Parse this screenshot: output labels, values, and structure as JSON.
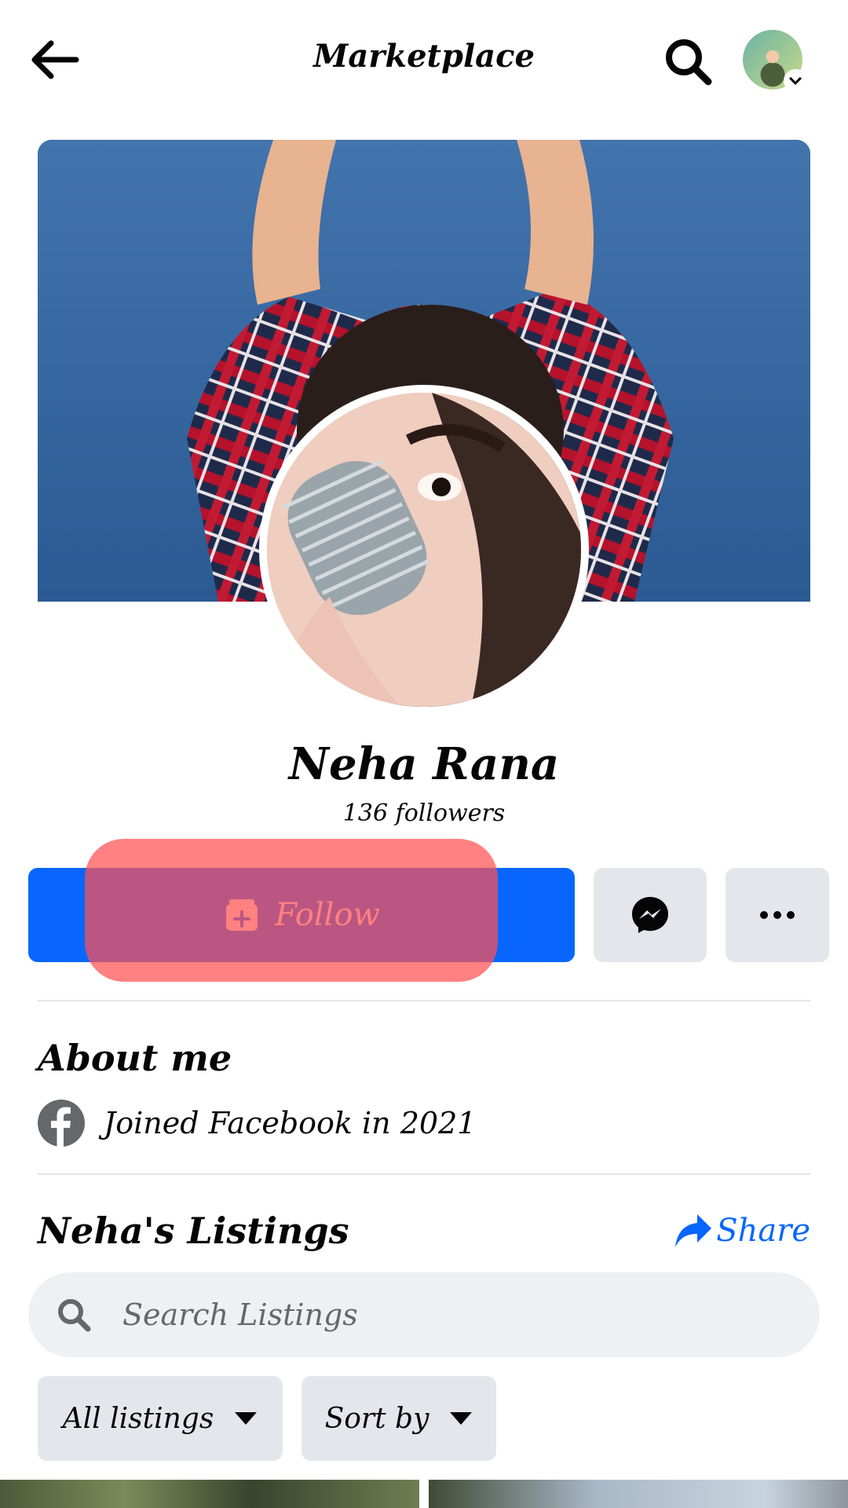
{
  "header": {
    "title": "Marketplace",
    "back_icon": "arrow-left-icon",
    "search_icon": "search-icon"
  },
  "profile": {
    "name": "Neha Rana",
    "followers": "136 followers"
  },
  "actions": {
    "follow_label": "Follow",
    "follow_icon": "follow-plus-icon",
    "messenger_icon": "messenger-icon",
    "more_icon": "more-icon"
  },
  "about": {
    "title": "About me",
    "joined": "Joined Facebook in 2021"
  },
  "listings": {
    "title": "Neha's Listings",
    "share_label": "Share",
    "search_placeholder": "Search Listings",
    "filters": [
      {
        "label": "All listings"
      },
      {
        "label": "Sort by"
      }
    ]
  },
  "colors": {
    "accent": "#0866ff",
    "button_gray": "#e4e6eb",
    "highlight": "#ff5050"
  }
}
